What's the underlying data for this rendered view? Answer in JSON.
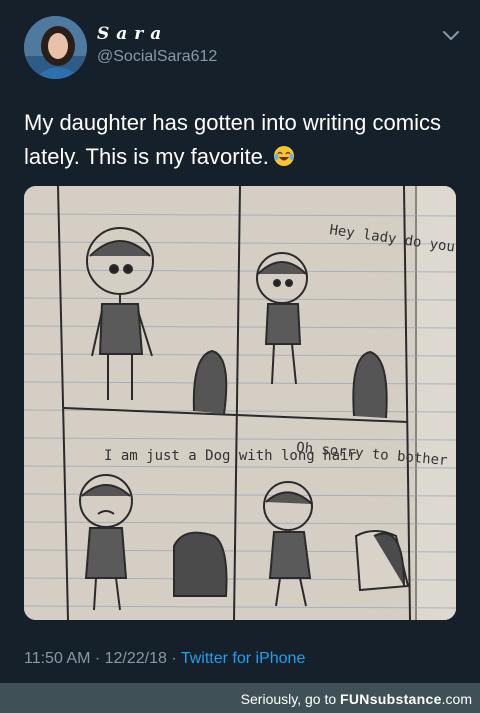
{
  "tweet": {
    "display_name": "Sara",
    "handle": "@SocialSara612",
    "text": "My daughter has gotten into writing comics lately. This is my favorite.",
    "timestamp": "11:50 AM · 12/22/18 · ",
    "source": "Twitter for iPhone",
    "emoji": "face-with-tears-of-joy"
  },
  "comic": {
    "panel2_text": "Hey lady do you want to go on a date?",
    "panel3_text": "I am just a Dog with long hair",
    "panel4_text": "Oh sorry to bother you"
  },
  "footer": {
    "prefix": "Seriously, go to ",
    "brand": "FUNsubstance",
    "suffix": ".com"
  },
  "colors": {
    "background": "#15202b",
    "text": "#ffffff",
    "secondary": "#8899a6",
    "link": "#1da1f2",
    "footer_bg": "#3f5056"
  }
}
